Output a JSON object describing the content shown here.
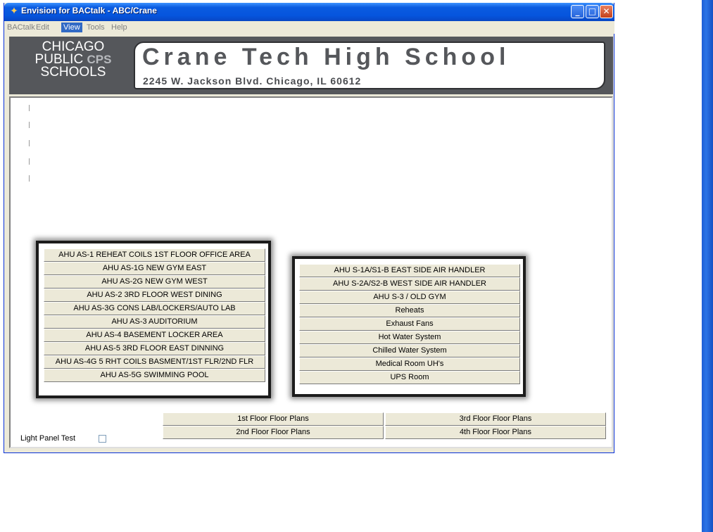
{
  "window": {
    "title": "Envision for BACtalk - ABC/Crane",
    "controls": {
      "minimize": "_",
      "maximize": "□",
      "close": "✕"
    }
  },
  "menu": [
    "BACtalk",
    "Edit",
    "View",
    "Tools",
    "Help"
  ],
  "banner": {
    "logo_lines": [
      "CHICAGO",
      "PUBLIC",
      "SCHOOLS"
    ],
    "logo_mark": "CPS",
    "school_name": "Crane Tech High School",
    "address": "2245 W. Jackson Blvd. Chicago, IL 60612"
  },
  "left_panel_buttons": [
    "AHU AS-1 REHEAT COILS 1ST FLOOR OFFICE AREA",
    "AHU AS-1G NEW GYM EAST",
    "AHU AS-2G NEW GYM WEST",
    "AHU AS-2 3RD FLOOR WEST DINING",
    "AHU AS-3G CONS LAB/LOCKERS/AUTO LAB",
    "AHU AS-3 AUDITORIUM",
    "AHU AS-4 BASEMENT LOCKER AREA",
    "AHU AS-5 3RD FLOOR EAST DINNING",
    "AHU AS-4G 5 RHT COILS BASMENT/1ST FLR/2ND FLR",
    "AHU AS-5G SWIMMING POOL"
  ],
  "right_panel_buttons": [
    "AHU S-1A/S1-B EAST SIDE AIR HANDLER",
    "AHU S-2A/S2-B WEST SIDE AIR HANDLER",
    "AHU S-3 / OLD GYM",
    "Reheats",
    "Exhaust Fans",
    "Hot Water System",
    "Chilled Water System",
    "Medical Room UH's",
    "UPS Room"
  ],
  "floor_plans": {
    "first": "1st Floor Floor Plans",
    "second": "2nd Floor Floor Plans",
    "third": "3rd Floor Floor Plans",
    "fourth": "4th Floor Floor Plans"
  },
  "light_panel_test": {
    "label": "Light Panel Test",
    "checked": false
  }
}
